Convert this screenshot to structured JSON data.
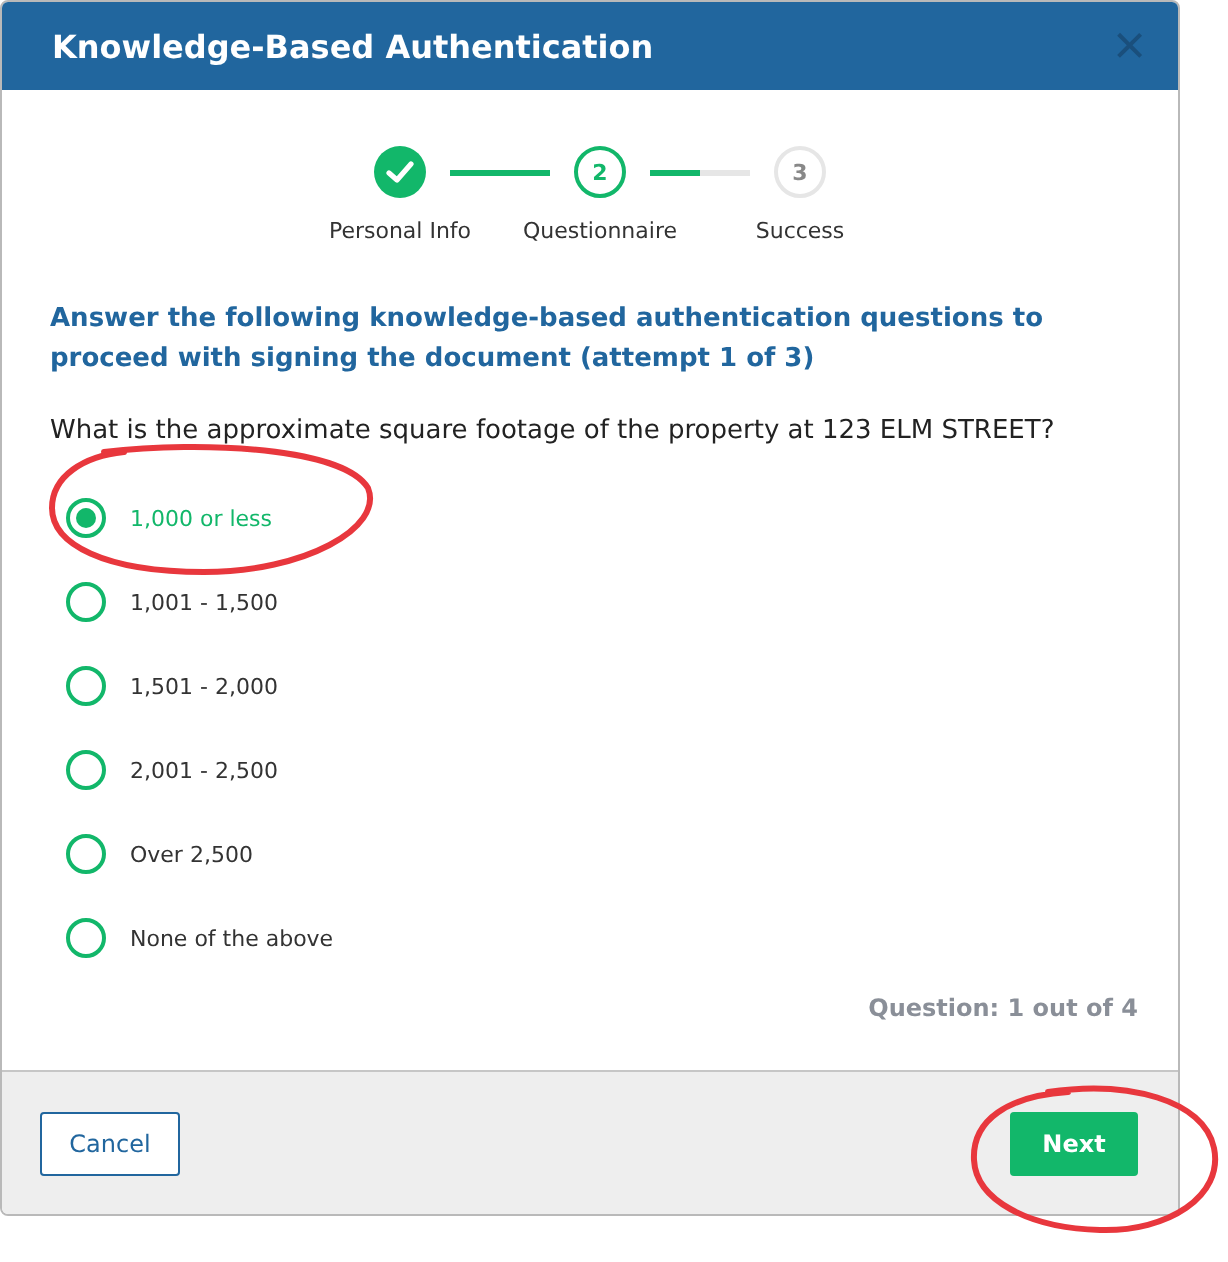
{
  "window": {
    "title": "Knowledge-Based Authentication",
    "close": "×"
  },
  "steps": [
    {
      "label": "Personal Info",
      "completed": true,
      "current": false
    },
    {
      "label": "Questionnaire",
      "completed": false,
      "current": true,
      "number": "2"
    },
    {
      "label": "Success",
      "completed": false,
      "current": false,
      "number": "3"
    }
  ],
  "connectors": [
    {
      "level": 1
    },
    {
      "level": 0.5
    }
  ],
  "instructions": "Answer the following knowledge-based authentication questions to proceed with signing the document (attempt 1 of 3)",
  "question": "What is the approximate square footage of the property at 123 ELM STREET?",
  "options": [
    {
      "label": "1,000 or less",
      "selected": true
    },
    {
      "label": "1,001 - 1,500",
      "selected": false
    },
    {
      "label": "1,501 - 2,000",
      "selected": false
    },
    {
      "label": "2,001 - 2,500",
      "selected": false
    },
    {
      "label": "Over 2,500",
      "selected": false
    },
    {
      "label": "None of the above",
      "selected": false
    }
  ],
  "progress": "Question: 1 out of 4",
  "buttons": {
    "cancel": "Cancel",
    "next": "Next"
  }
}
